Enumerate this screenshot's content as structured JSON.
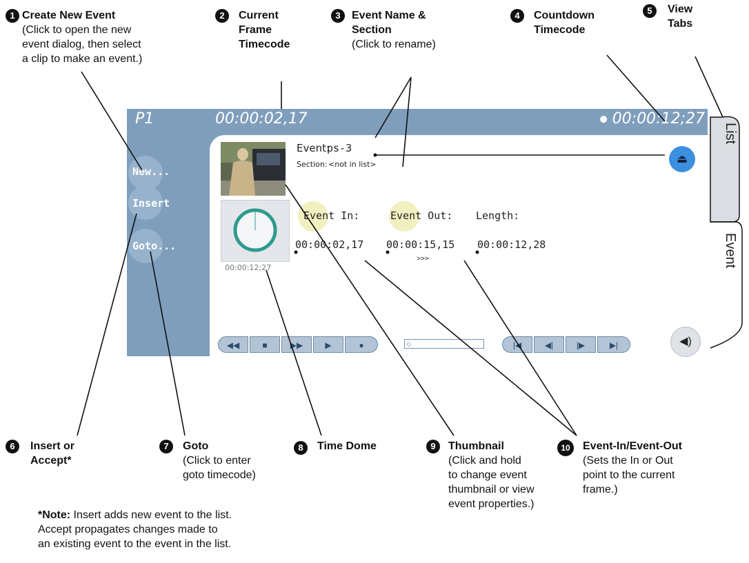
{
  "callouts": {
    "c1": {
      "num": "1",
      "title": "Create New Event",
      "desc_lines": [
        "(Click to open the new",
        "event dialog, then select",
        "a clip to make an event.)"
      ]
    },
    "c2": {
      "num": "2",
      "title_lines": [
        "Current",
        "Frame",
        "Timecode"
      ]
    },
    "c3": {
      "num": "3",
      "title_lines": [
        "Event Name &",
        "Section"
      ],
      "desc": "(Click to rename)"
    },
    "c4": {
      "num": "4",
      "title_lines": [
        "Countdown",
        "Timecode"
      ]
    },
    "c5": {
      "num": "5",
      "title_lines": [
        "View",
        "Tabs"
      ]
    },
    "c6": {
      "num": "6",
      "title_lines": [
        "Insert or",
        "Accept*"
      ]
    },
    "c7": {
      "num": "7",
      "title": "Goto",
      "desc_lines": [
        "(Click to enter",
        "goto timecode)"
      ]
    },
    "c8": {
      "num": "8",
      "title": "Time Dome"
    },
    "c9": {
      "num": "9",
      "title": "Thumbnail",
      "desc_lines": [
        "(Click and hold",
        "to change event",
        "thumbnail or view",
        "event properties.)"
      ]
    },
    "c10": {
      "num": "10",
      "title": "Event-In/Event-Out",
      "desc_lines": [
        "(Sets the In or Out",
        "point to the current",
        "frame.)"
      ]
    }
  },
  "note": {
    "bold": "*Note:",
    "lines": [
      " Insert adds new event  to the list.",
      "Accept propagates changes made to",
      "an existing event to the event in the list."
    ]
  },
  "app": {
    "channel": "P1",
    "current_timecode": "00:00:02,17",
    "countdown_timecode": "00:00:12;27",
    "sidebar": {
      "new": "New...",
      "insert": "Insert",
      "goto": "Goto..."
    },
    "event_label": "Event:",
    "event_name": "ps-3",
    "section_label": "Section:",
    "section_name": "<not in list>",
    "dome_timecode": "00:00:12;27",
    "event_in_label": "Event In:",
    "event_out_label": "Event Out:",
    "length_label": "Length:",
    "event_in": "00:00:02,17",
    "event_out": "00:00:15,15",
    "length": "00:00:12,28",
    "arrows": ">>>",
    "tabs": {
      "list": "List",
      "event": "Event"
    }
  },
  "colors": {
    "panel": "#7f9ebc",
    "eject": "#3b8fdf",
    "glow": "#f1f0c0",
    "dome_ring": "#2f9a8f"
  }
}
